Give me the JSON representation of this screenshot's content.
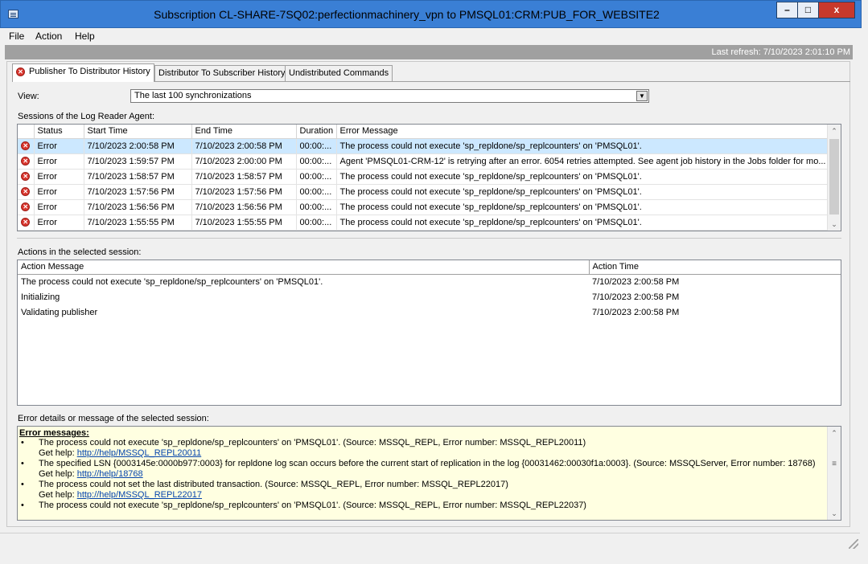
{
  "window": {
    "title": "Subscription CL-SHARE-7SQ02:perfectionmachinery_vpn to PMSQL01:CRM:PUB_FOR_WEBSITE2",
    "min_glyph": "–",
    "max_glyph": "□",
    "close_glyph": "x"
  },
  "menu": {
    "file": "File",
    "action": "Action",
    "help": "Help"
  },
  "refresh": {
    "text": "Last refresh: 7/10/2023 2:01:10 PM"
  },
  "tabs": [
    {
      "label": "Publisher To Distributor History",
      "icon": "error-icon"
    },
    {
      "label": "Distributor To Subscriber History"
    },
    {
      "label": "Undistributed Commands"
    }
  ],
  "view": {
    "label": "View:",
    "selected": "The last 100 synchronizations"
  },
  "sessions": {
    "label": "Sessions of the Log Reader Agent:",
    "columns": [
      "",
      "Status",
      "Start Time",
      "End Time",
      "Duration",
      "Error Message"
    ],
    "rows": [
      {
        "status": "Error",
        "start": "7/10/2023 2:00:58 PM",
        "end": "7/10/2023 2:00:58 PM",
        "duration": "00:00:...",
        "message": "The process could not execute 'sp_repldone/sp_replcounters' on 'PMSQL01'."
      },
      {
        "status": "Error",
        "start": "7/10/2023 1:59:57 PM",
        "end": "7/10/2023 2:00:00 PM",
        "duration": "00:00:...",
        "message": "Agent 'PMSQL01-CRM-12' is retrying after an error. 6054 retries attempted. See agent job history in the Jobs folder for mo..."
      },
      {
        "status": "Error",
        "start": "7/10/2023 1:58:57 PM",
        "end": "7/10/2023 1:58:57 PM",
        "duration": "00:00:...",
        "message": "The process could not execute 'sp_repldone/sp_replcounters' on 'PMSQL01'."
      },
      {
        "status": "Error",
        "start": "7/10/2023 1:57:56 PM",
        "end": "7/10/2023 1:57:56 PM",
        "duration": "00:00:...",
        "message": "The process could not execute 'sp_repldone/sp_replcounters' on 'PMSQL01'."
      },
      {
        "status": "Error",
        "start": "7/10/2023 1:56:56 PM",
        "end": "7/10/2023 1:56:56 PM",
        "duration": "00:00:...",
        "message": "The process could not execute 'sp_repldone/sp_replcounters' on 'PMSQL01'."
      },
      {
        "status": "Error",
        "start": "7/10/2023 1:55:55 PM",
        "end": "7/10/2023 1:55:55 PM",
        "duration": "00:00:...",
        "message": "The process could not execute 'sp_repldone/sp_replcounters' on 'PMSQL01'."
      }
    ]
  },
  "actions": {
    "label": "Actions in the selected session:",
    "columns": [
      "Action Message",
      "Action Time"
    ],
    "rows": [
      {
        "message": "The process could not execute 'sp_repldone/sp_replcounters' on 'PMSQL01'.",
        "time": "7/10/2023 2:00:58 PM"
      },
      {
        "message": "Initializing",
        "time": "7/10/2023 2:00:58 PM"
      },
      {
        "message": "Validating publisher",
        "time": "7/10/2023 2:00:58 PM"
      }
    ]
  },
  "error_details": {
    "label": "Error details or message of the selected session:",
    "heading": "Error messages:",
    "help_prefix": "Get help:",
    "items": [
      {
        "text": "The process could not execute 'sp_repldone/sp_replcounters' on 'PMSQL01'. (Source: MSSQL_REPL, Error number: MSSQL_REPL20011)",
        "help": "http://help/MSSQL_REPL20011"
      },
      {
        "text": "The specified LSN {0003145e:0000b977:0003} for repldone log scan occurs before the current start of replication in the log {00031462:00030f1a:0003}. (Source: MSSQLServer, Error number: 18768)",
        "help": "http://help/18768"
      },
      {
        "text": "The process could not set the last distributed transaction. (Source: MSSQL_REPL, Error number: MSSQL_REPL22017)",
        "help": "http://help/MSSQL_REPL22017"
      },
      {
        "text": "The process could not execute 'sp_repldone/sp_replcounters' on 'PMSQL01'. (Source: MSSQL_REPL, Error number: MSSQL_REPL22037)",
        "help": ""
      }
    ]
  },
  "glyphs": {
    "error": "✕",
    "up": "⌃",
    "down": "⌄",
    "mid": "≡",
    "drop": "▼"
  },
  "colors": {
    "titlebar": "#3a7fd5",
    "selection": "#cce8ff",
    "error_red": "#d9352d",
    "error_bg": "#ffffe1",
    "link": "#0645ad"
  }
}
